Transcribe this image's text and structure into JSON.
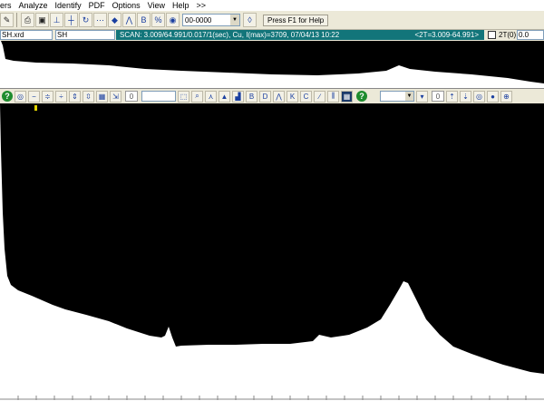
{
  "menu": {
    "items": [
      "ers",
      "Analyze",
      "Identify",
      "PDF",
      "Options",
      "View",
      "Help",
      ">>"
    ]
  },
  "toolbar": {
    "combo_value": "00-0000",
    "help_text": "Press F1 for Help"
  },
  "status": {
    "file_name": "SH.xrd",
    "sample_name": "SH",
    "scan_info": "SCAN: 3.009/64.991/0.017/1(sec), Cu, I(max)=3709, 07/04/13 10:22",
    "range_info": "<2T=3.009-64.991>",
    "two_theta_label": "2T(0)",
    "two_theta_value": "0.0"
  },
  "toolbar2": {
    "counter_left": "0",
    "counter_right": "0"
  },
  "colors": {
    "toolbar_bg": "#ece9d8",
    "scan_bar": "#12757a",
    "plot_fill": "#000000",
    "help_green": "#1e8c2e"
  }
}
